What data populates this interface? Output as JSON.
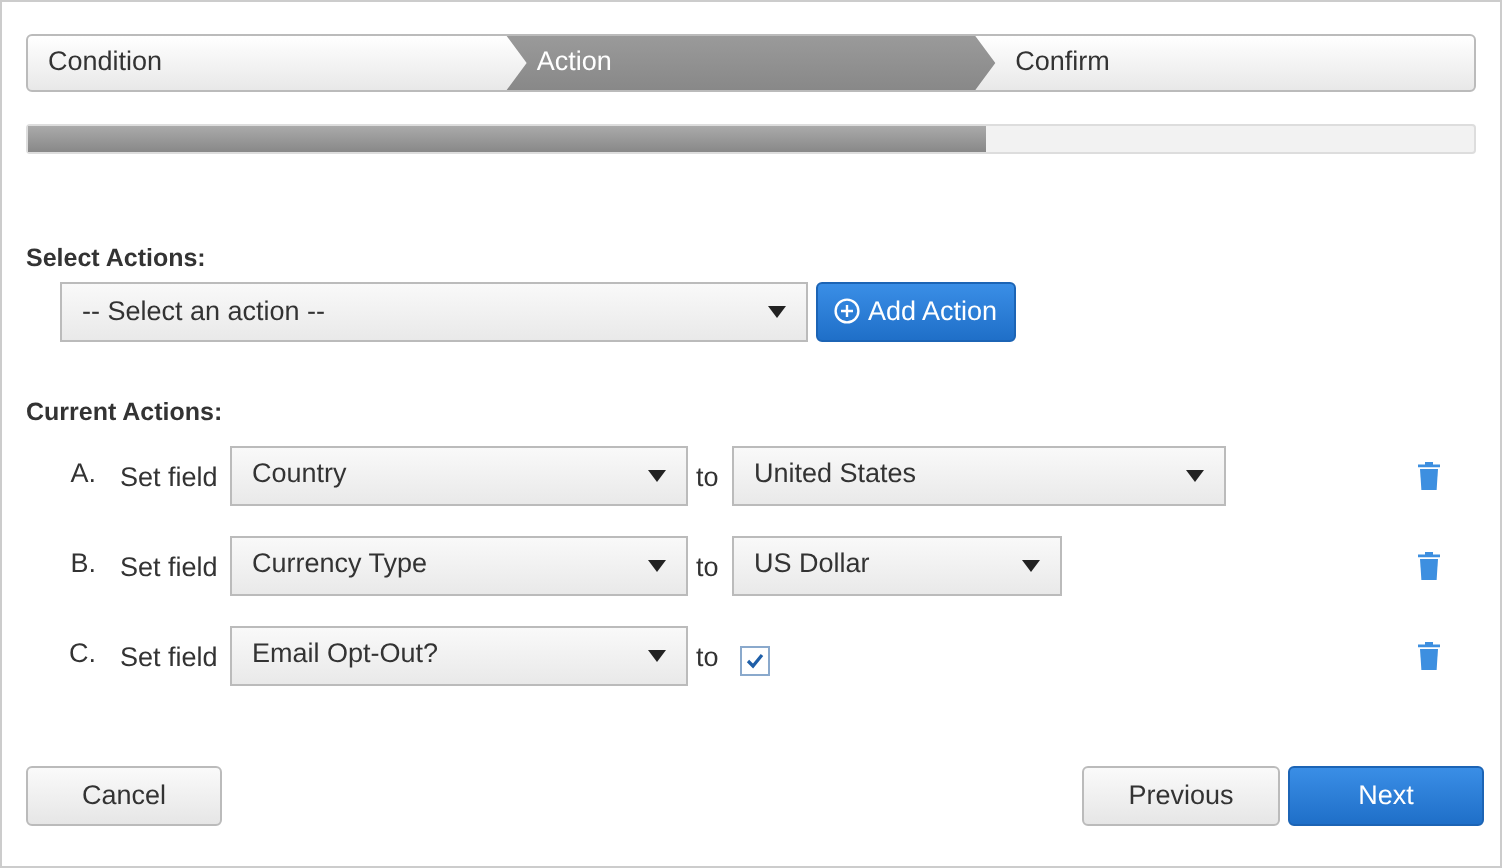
{
  "steps": [
    {
      "label": "Condition",
      "selected": false
    },
    {
      "label": "Action",
      "selected": true
    },
    {
      "label": "Confirm",
      "selected": false
    }
  ],
  "progress": {
    "level": 0.662
  },
  "select_actions": {
    "label": "Select Actions:",
    "dropdown": "-- Select an action --",
    "button": "Add Action"
  },
  "current_actions": {
    "label": "Current Actions:",
    "items": [
      {
        "letter": "A.",
        "prefix": "Set field",
        "field": "Country",
        "to": "to",
        "kind": "select",
        "value": "United States"
      },
      {
        "letter": "B.",
        "prefix": "Set field",
        "field": "Currency Type",
        "to": "to",
        "kind": "select",
        "value": "US Dollar"
      },
      {
        "letter": "C.",
        "prefix": "Set field",
        "field": "Email Opt-Out?",
        "to": "to",
        "kind": "checkbox",
        "checked": true
      }
    ]
  },
  "footer": {
    "cancel": "Cancel",
    "previous": "Previous",
    "next": "Next"
  }
}
